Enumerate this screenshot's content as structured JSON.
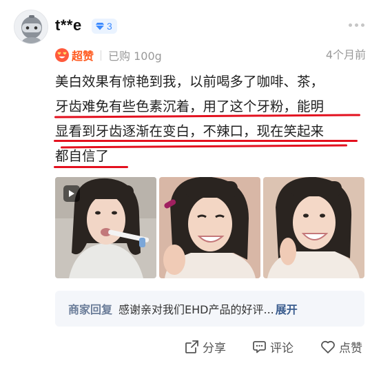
{
  "user": {
    "name": "t**e",
    "level": "3",
    "avatar_icon": "robot-avatar-icon",
    "level_icon": "diamond-icon"
  },
  "review": {
    "rating_label": "超赞",
    "purchase_info": "已购 100g",
    "timestamp": "4个月前",
    "lines": [
      "美白效果有惊艳到我，以前喝多了咖啡、茶，",
      "牙齿难免有些色素沉着，用了这个牙粉，能明",
      "显看到牙齿逐渐在变白，不辣口，现在笑起来",
      "都自信了"
    ]
  },
  "photos": [
    {
      "type": "video",
      "icon": "play-icon"
    },
    {
      "type": "image"
    },
    {
      "type": "image"
    }
  ],
  "merchant_reply": {
    "label": "商家回复",
    "text": "感谢亲对我们EHD产品的好评...",
    "expand": "展开"
  },
  "actions": {
    "share": "分享",
    "comment": "评论",
    "like": "点赞"
  },
  "colors": {
    "accent_red": "#e3101e",
    "rating_orange": "#ff5a1f",
    "level_blue": "#3d8bff",
    "reply_bg": "#f4f6fa"
  }
}
